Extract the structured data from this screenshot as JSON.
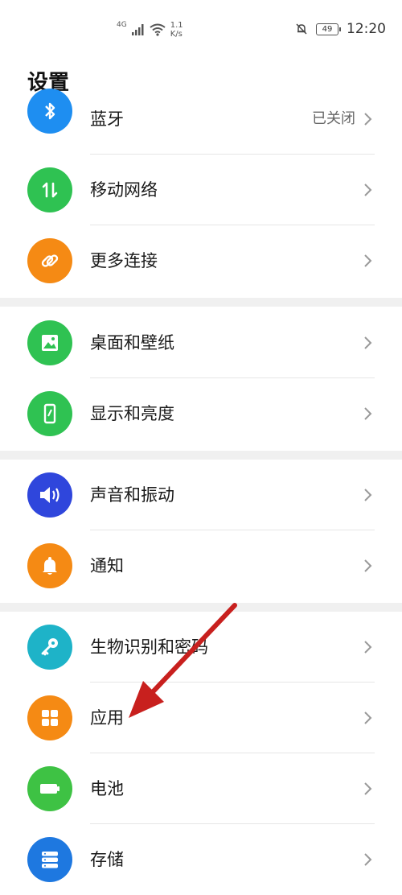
{
  "status_bar": {
    "network": "4G",
    "speed": "1.1",
    "speed_unit": "K/s",
    "battery": "49",
    "time": "12:20"
  },
  "page": {
    "title": "设置"
  },
  "settings": [
    {
      "label": "蓝牙",
      "value": "已关闭",
      "icon": "bluetooth-icon",
      "color": "#1e8ef1"
    },
    {
      "label": "移动网络",
      "icon": "mobile-network-icon",
      "color": "#2fc252"
    },
    {
      "label": "更多连接",
      "icon": "link-icon",
      "color": "#f58a14"
    },
    {
      "label": "桌面和壁纸",
      "icon": "wallpaper-icon",
      "color": "#2fc252"
    },
    {
      "label": "显示和亮度",
      "icon": "display-icon",
      "color": "#2fc252"
    },
    {
      "label": "声音和振动",
      "icon": "sound-icon",
      "color": "#2f46dc"
    },
    {
      "label": "通知",
      "icon": "bell-icon",
      "color": "#f58a14"
    },
    {
      "label": "生物识别和密码",
      "icon": "key-icon",
      "color": "#1eb3c8"
    },
    {
      "label": "应用",
      "icon": "apps-icon",
      "color": "#f58a14"
    },
    {
      "label": "电池",
      "icon": "battery-icon",
      "color": "#3ec244"
    },
    {
      "label": "存储",
      "icon": "storage-icon",
      "color": "#1e78e0"
    }
  ],
  "annotation": {
    "arrow_color": "#c8201e"
  }
}
